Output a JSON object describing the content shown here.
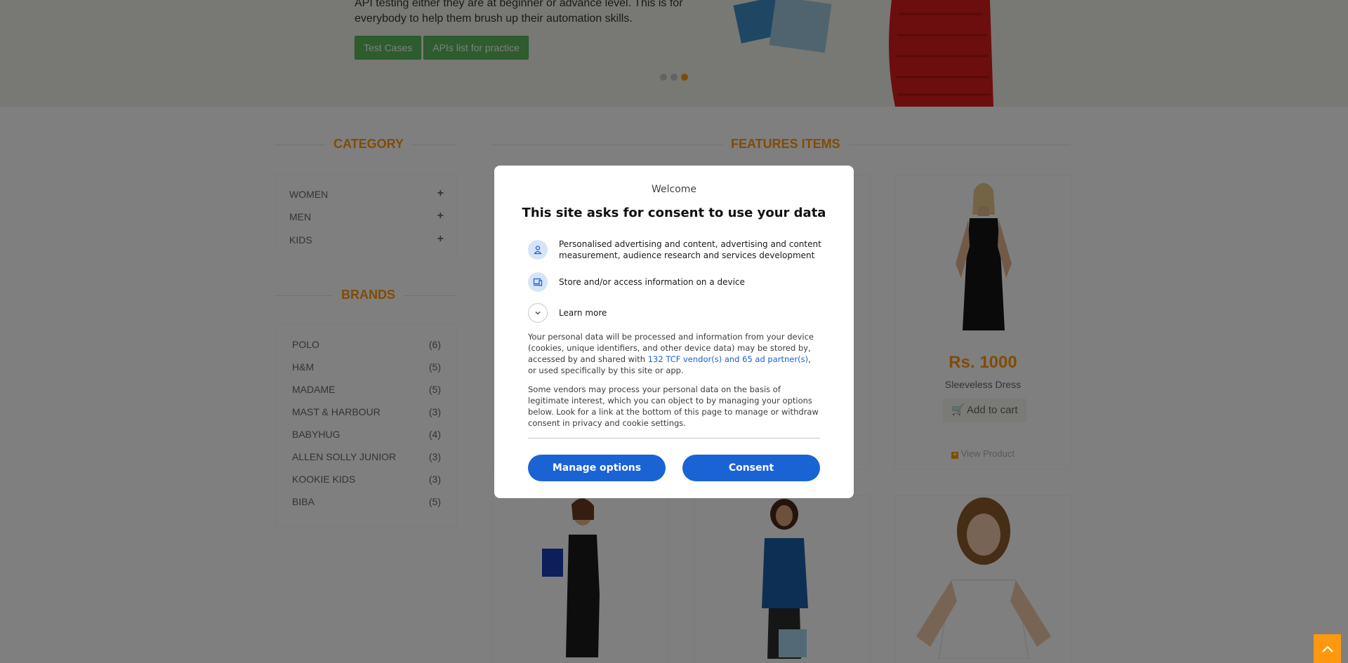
{
  "hero": {
    "text": "API testing either they are at beginner or advance level. This is for everybody to help them brush up their automation skills.",
    "buttons": [
      "Test Cases",
      "APIs list for practice"
    ],
    "slide_count": 3,
    "active_slide": 3
  },
  "sidebar": {
    "category_title": "Category",
    "categories": [
      {
        "label": "Women",
        "icon": "plus-icon"
      },
      {
        "label": "Men",
        "icon": "plus-icon"
      },
      {
        "label": "Kids",
        "icon": "plus-icon"
      }
    ],
    "brands_title": "Brands",
    "brands": [
      {
        "name": "POLO",
        "count": "(6)"
      },
      {
        "name": "H&M",
        "count": "(5)"
      },
      {
        "name": "MADAME",
        "count": "(5)"
      },
      {
        "name": "MAST & HARBOUR",
        "count": "(3)"
      },
      {
        "name": "BABYHUG",
        "count": "(4)"
      },
      {
        "name": "ALLEN SOLLY JUNIOR",
        "count": "(3)"
      },
      {
        "name": "KOOKIE KIDS",
        "count": "(3)"
      },
      {
        "name": "BIBA",
        "count": "(5)"
      }
    ]
  },
  "features": {
    "title": "Features Items",
    "visible_product": {
      "price": "Rs. 1000",
      "name": "Sleeveless Dress",
      "add_to_cart": "Add to cart",
      "view_product": "View Product"
    }
  },
  "consent": {
    "welcome": "Welcome",
    "title": "This site asks for consent to use your data",
    "purposes": [
      {
        "text": "Personalised advertising and content, advertising and content measurement, audience research and services development",
        "icon": "person-icon"
      },
      {
        "text": "Store and/or access information on a device",
        "icon": "device-icon"
      }
    ],
    "learn_more": "Learn more",
    "para1_before": "Your personal data will be processed and information from your device (cookies, unique identifiers, and other device data) may be stored by, accessed by and shared with ",
    "para1_link": "132 TCF vendor(s) and 65 ad partner(s)",
    "para1_after": ", or used specifically by this site or app.",
    "para2": "Some vendors may process your personal data on the basis of legitimate interest, which you can object to by managing your options below. Look for a link at the bottom of this page to manage or withdraw consent in privacy and cookie settings.",
    "manage_label": "Manage options",
    "consent_label": "Consent",
    "accent": "#1a63d4"
  },
  "colors": {
    "brand": "#FE980F",
    "hero_button": "#5cb85c"
  }
}
